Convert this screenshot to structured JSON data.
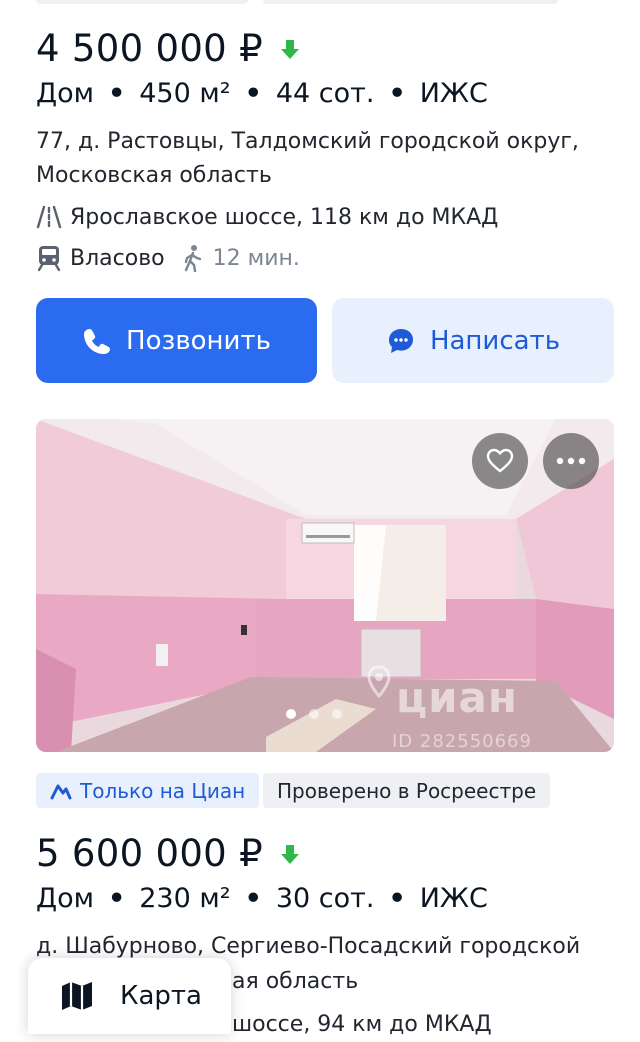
{
  "listing1": {
    "price": "4 500 000 ₽",
    "type": "Дом",
    "area": "450 м²",
    "land": "44 сот.",
    "category": "ИЖС",
    "address": "77, д. Растовцы, Талдомский городской округ, Московская область",
    "highway": "Ярославское шоссе, 118 км до МКАД",
    "station": "Власово",
    "walk_time": "12 мин.",
    "call_label": "Позвонить",
    "message_label": "Написать"
  },
  "listing2": {
    "photo": {
      "watermark": "циан",
      "watermark_id": "ID 282550669",
      "slide_count": 3,
      "active_slide": 0
    },
    "tag_cian": "Только на Циан",
    "tag_verified": "Проверено в Росреестре",
    "price": "5 600 000 ₽",
    "type": "Дом",
    "area": "230 м²",
    "land": "30 сот.",
    "category": "ИЖС",
    "address": "д. Шабурново, Сергиево-Посадский городской",
    "address_line2_visible": "ая область",
    "highway_visible": "шоссе, 94 км до МКАД"
  },
  "map_button": {
    "label": "Карта"
  },
  "colors": {
    "primary": "#2b6bf0",
    "primary_light": "#e8f0fd",
    "price_drop": "#2fb84a",
    "tag_gray": "#eef0f3"
  },
  "icons": [
    "price-down-arrow-icon",
    "highway-icon",
    "train-icon",
    "walk-icon",
    "phone-icon",
    "chat-icon",
    "heart-icon",
    "more-icon",
    "cian-logo-icon",
    "map-icon"
  ]
}
